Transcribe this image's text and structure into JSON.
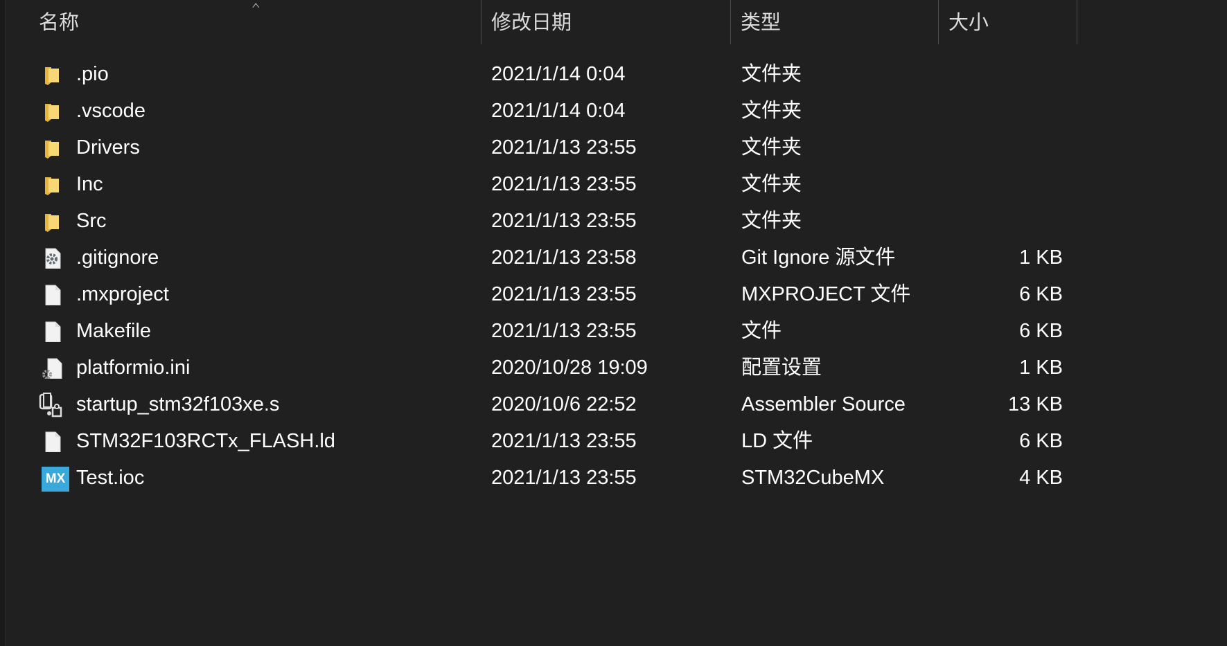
{
  "columns": {
    "name": "名称",
    "date": "修改日期",
    "type": "类型",
    "size": "大小"
  },
  "sort": {
    "column": "name",
    "direction": "ascending"
  },
  "colors": {
    "background": "#202020",
    "folder": "#f5c94e",
    "mx_badge": "#3ba8dc"
  },
  "files": [
    {
      "name": ".pio",
      "date": "2021/1/14 0:04",
      "type": "文件夹",
      "size": "",
      "icon": "folder-icon"
    },
    {
      "name": ".vscode",
      "date": "2021/1/14 0:04",
      "type": "文件夹",
      "size": "",
      "icon": "folder-icon"
    },
    {
      "name": "Drivers",
      "date": "2021/1/13 23:55",
      "type": "文件夹",
      "size": "",
      "icon": "folder-icon"
    },
    {
      "name": "Inc",
      "date": "2021/1/13 23:55",
      "type": "文件夹",
      "size": "",
      "icon": "folder-icon"
    },
    {
      "name": "Src",
      "date": "2021/1/13 23:55",
      "type": "文件夹",
      "size": "",
      "icon": "folder-icon"
    },
    {
      "name": ".gitignore",
      "date": "2021/1/13 23:58",
      "type": "Git Ignore 源文件",
      "size": "1 KB",
      "icon": "gear-file-icon"
    },
    {
      "name": ".mxproject",
      "date": "2021/1/13 23:55",
      "type": "MXPROJECT 文件",
      "size": "6 KB",
      "icon": "file-icon"
    },
    {
      "name": "Makefile",
      "date": "2021/1/13 23:55",
      "type": "文件",
      "size": "6 KB",
      "icon": "file-icon"
    },
    {
      "name": "platformio.ini",
      "date": "2020/10/28 19:09",
      "type": "配置设置",
      "size": "1 KB",
      "icon": "settings-file-icon"
    },
    {
      "name": "startup_stm32f103xe.s",
      "date": "2020/10/6 22:52",
      "type": "Assembler Source",
      "size": "13 KB",
      "icon": "assembler-file-icon"
    },
    {
      "name": "STM32F103RCTx_FLASH.ld",
      "date": "2021/1/13 23:55",
      "type": "LD 文件",
      "size": "6 KB",
      "icon": "file-icon"
    },
    {
      "name": "Test.ioc",
      "date": "2021/1/13 23:55",
      "type": "STM32CubeMX",
      "size": "4 KB",
      "icon": "stm32cubemx-icon",
      "badge": "MX"
    }
  ]
}
